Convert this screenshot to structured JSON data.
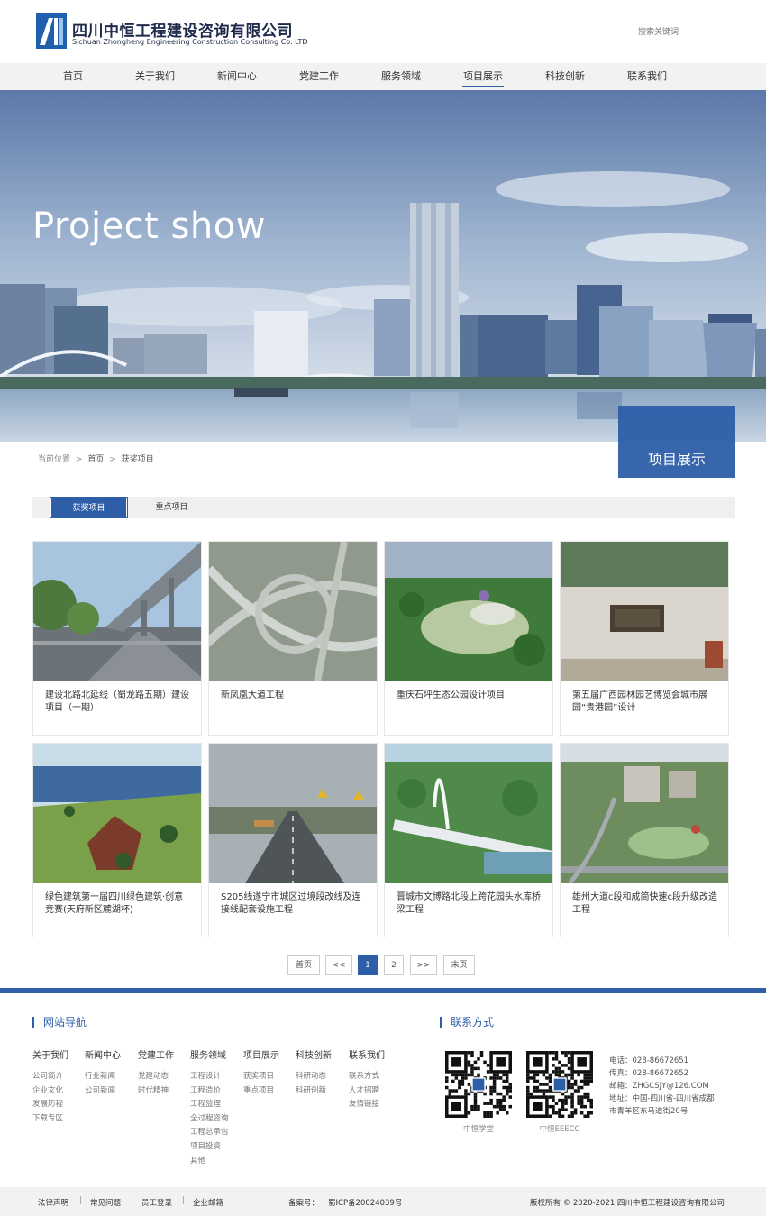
{
  "header": {
    "company_cn": "四川中恒工程建设咨询有限公司",
    "company_en": "Sichuan Zhongheng Engineering Construction Consulting Co. LTD",
    "search_placeholder": "搜索关键词"
  },
  "nav": {
    "items": [
      {
        "label": "首页",
        "active": false
      },
      {
        "label": "关于我们",
        "active": false
      },
      {
        "label": "新闻中心",
        "active": false
      },
      {
        "label": "党建工作",
        "active": false
      },
      {
        "label": "服务领域",
        "active": false
      },
      {
        "label": "项目展示",
        "active": true
      },
      {
        "label": "科技创新",
        "active": false
      },
      {
        "label": "联系我们",
        "active": false
      }
    ]
  },
  "banner": {
    "title": "Project show",
    "section_label": "项目展示"
  },
  "breadcrumb": {
    "prefix": "当前位置",
    "sep": ">",
    "home": "首页",
    "current": "获奖项目"
  },
  "tabs": [
    {
      "label": "获奖项目",
      "active": true
    },
    {
      "label": "重点项目",
      "active": false
    }
  ],
  "projects": [
    {
      "title": "建设北路北延线（蜀龙路五期）建设项目（一期）",
      "image": "elevated-highway"
    },
    {
      "title": "新凤凰大道工程",
      "image": "interchange"
    },
    {
      "title": "重庆石坪生态公园设计项目",
      "image": "eco-park"
    },
    {
      "title": "第五届广西园林园艺博览会城市展园“贵港园”设计",
      "image": "garden-gate"
    },
    {
      "title": "绿色建筑第一届四川绿色建筑·创意竞赛(天府新区麓湖杯)",
      "image": "green-building"
    },
    {
      "title": "S205线遂宁市城区过境段改线及连接线配套设施工程",
      "image": "rural-road"
    },
    {
      "title": "晋城市文博路北段上跨花园头水库桥梁工程",
      "image": "arch-bridge"
    },
    {
      "title": "雄州大道c段和成简快速c段升级改造工程",
      "image": "city-aerial"
    }
  ],
  "pagination": {
    "first": "首页",
    "prev": "<<",
    "pages": [
      "1",
      "2"
    ],
    "current": "1",
    "next": ">>",
    "last": "末页"
  },
  "footer": {
    "nav_heading": "网站导航",
    "contact_heading": "联系方式",
    "columns": [
      {
        "title": "关于我们",
        "links": [
          "公司简介",
          "企业文化",
          "发展历程",
          "下载专区"
        ]
      },
      {
        "title": "新闻中心",
        "links": [
          "行业新闻",
          "公司新闻"
        ]
      },
      {
        "title": "党建工作",
        "links": [
          "党建动态",
          "时代精神"
        ]
      },
      {
        "title": "服务领域",
        "links": [
          "工程设计",
          "工程造价",
          "工程监理",
          "全过程咨询",
          "工程总承包",
          "项目投资",
          "其他"
        ]
      },
      {
        "title": "项目展示",
        "links": [
          "获奖项目",
          "重点项目"
        ]
      },
      {
        "title": "科技创新",
        "links": [
          "科研动态",
          "科研创新"
        ]
      },
      {
        "title": "联系我们",
        "links": [
          "联系方式",
          "人才招聘",
          "友情链接"
        ]
      }
    ],
    "qr_codes": [
      {
        "caption": "中恒学堂"
      },
      {
        "caption": "中恒EEECC"
      }
    ],
    "contact_lines": [
      "电话：028-86672651",
      "传真：028-86672652",
      "邮箱：ZHGCSJY@126.COM",
      "地址：中国-四川省-四川省成都",
      "市青羊区东马道街20号"
    ]
  },
  "bottom": {
    "links": [
      "法律声明",
      "常见问题",
      "员工登录",
      "企业邮箱"
    ],
    "separator": "|",
    "icp_label": "备案号：",
    "icp_value": "蜀ICP备20024039号",
    "copyright": "版权所有 © 2020-2021 四川中恒工程建设咨询有限公司"
  },
  "colors": {
    "accent": "#2e5ea8",
    "nav_bg": "#f2f2f2",
    "text": "#333333"
  }
}
